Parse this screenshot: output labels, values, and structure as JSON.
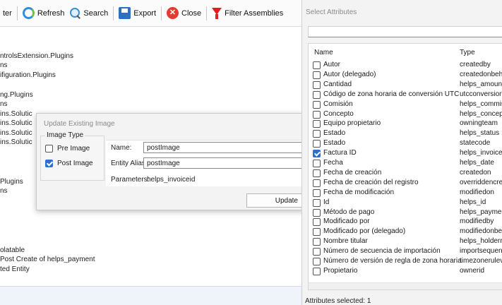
{
  "toolbar": {
    "partial_label": "ter",
    "refresh_label": "Refresh",
    "search_label": "Search",
    "export_label": "Export",
    "close_label": "Close",
    "filter_label": "Filter Assemblies"
  },
  "tree_lines": [
    "ntrolsExtension.Plugins",
    "ns",
    "ifiguration.Plugins",
    "ng.Plugins",
    "ns",
    "ins.Solutic",
    "ins.Solutic",
    "ins.Solutic",
    "ins.Solutic",
    "Plugins",
    "ns",
    "olatable",
    " Post Create of helps_payment",
    "ted Entity"
  ],
  "dialog": {
    "title": "Update Existing Image",
    "image_type_label": "Image Type",
    "pre_image_label": "Pre Image",
    "pre_image_checked": false,
    "post_image_label": "Post Image",
    "post_image_checked": true,
    "name_label": "Name:",
    "name_value": "postImage",
    "entity_alias_label": "Entity Alias:",
    "entity_alias_value": "postImage",
    "parameters_label": "Parameters:",
    "parameters_value": "helps_invoiceid",
    "update_label": "Update"
  },
  "select_attributes": {
    "title": "Select Attributes",
    "search_value": "",
    "col_name": "Name",
    "col_type": "Type",
    "rows": [
      {
        "name": "Autor",
        "type": "createdby",
        "checked": false
      },
      {
        "name": "Autor (delegado)",
        "type": "createdonbehalf",
        "checked": false
      },
      {
        "name": "Cantidad",
        "type": "helps_amount",
        "checked": false
      },
      {
        "name": "Código de zona horaria de conversión UTC",
        "type": "utcconversiontim",
        "checked": false
      },
      {
        "name": "Comisión",
        "type": "helps_commissio",
        "checked": false
      },
      {
        "name": "Concepto",
        "type": "helps_concept",
        "checked": false
      },
      {
        "name": "Equipo propietario",
        "type": "owningteam",
        "checked": false
      },
      {
        "name": "Estado",
        "type": "helps_status",
        "checked": false
      },
      {
        "name": "Estado",
        "type": "statecode",
        "checked": false
      },
      {
        "name": "Factura ID",
        "type": "helps_invoiceid",
        "checked": true
      },
      {
        "name": "Fecha",
        "type": "helps_date",
        "checked": false
      },
      {
        "name": "Fecha de creación",
        "type": "createdon",
        "checked": false
      },
      {
        "name": "Fecha de creación del registro",
        "type": "overriddencreate",
        "checked": false
      },
      {
        "name": "Fecha de modificación",
        "type": "modifiedon",
        "checked": false
      },
      {
        "name": "Id",
        "type": "helps_id",
        "checked": false
      },
      {
        "name": "Método de pago",
        "type": "helps_paymentm",
        "checked": false
      },
      {
        "name": "Modificado por",
        "type": "modifiedby",
        "checked": false
      },
      {
        "name": "Modificado por (delegado)",
        "type": "modifiedonbehal",
        "checked": false
      },
      {
        "name": "Nombre titular",
        "type": "helps_holdernam",
        "checked": false
      },
      {
        "name": "Número de secuencia de importación",
        "type": "importsequencer",
        "checked": false
      },
      {
        "name": "Número de versión de regla de zona horaria",
        "type": "timezonerulevers",
        "checked": false
      },
      {
        "name": "Propietario",
        "type": "ownerid",
        "checked": false
      }
    ],
    "footer": "Attributes selected: 1"
  },
  "colors": {
    "accent": "#2c6fcd",
    "close_red": "#e03c31",
    "filter_red": "#e02020"
  }
}
